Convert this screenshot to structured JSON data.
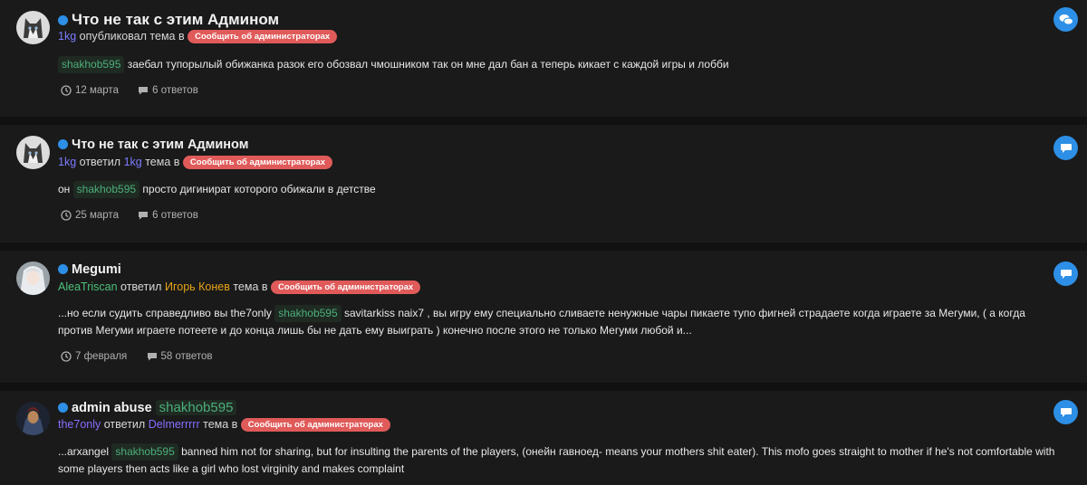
{
  "posts": [
    {
      "title": "Что не так с этим Админом",
      "actor": "1kg",
      "verb": "опубликовал тема в",
      "forum": "Сообщить об администраторах",
      "mention": "shakhob595",
      "text": "заебал тупорылый обижанка разок его обозвал чмошником так он мне дал бан а теперь кикает с каждой игры и лобби",
      "date": "12 марта",
      "replies": "6 ответов"
    },
    {
      "title": "Что не так с этим Админом",
      "actor": "1kg",
      "verb": "ответил",
      "target": "1kg",
      "verb2": "тема в",
      "forum": "Сообщить об администраторах",
      "text_before": "он",
      "mention": "shakhob595",
      "text": "просто дигинират которого обижали в детстве",
      "date": "25 марта",
      "replies": "6 ответов"
    },
    {
      "title": "Megumi",
      "actor": "AleaTriscan",
      "verb": "ответил",
      "target": "Игорь Конев",
      "verb2": "тема в",
      "forum": "Сообщить об администраторах",
      "text_before": "...но если судить справедливо вы the7only",
      "mention": "shakhob595",
      "text": "savitarkiss naix7 , вы игру ему специально сливаете ненужные чары пикаете тупо фигней страдаете когда играете за Мегуми, ( а когда против Мегуми играете потеете и до конца лишь бы не дать ему выиграть ) конечно после этого не только Мегуми любой и...",
      "date": "7 февраля",
      "replies": "58 ответов"
    },
    {
      "title": "admin abuse",
      "title_mention": "shakhob595",
      "actor": "the7only",
      "verb": "ответил",
      "target": "Delmerrrrr",
      "verb2": "тема в",
      "forum": "Сообщить об администраторах",
      "text_before": "...arxangel",
      "mention": "shakhob595",
      "text": "banned him not for sharing, but for insulting the parents of the players, (онейн гавноед- means your mothers shit eater). This mofo goes straight to mother if he's not comfortable with some players then acts like a girl who lost virginity and makes complaint"
    }
  ],
  "colors": {
    "accent": "#2d8fe6",
    "forum_pill": "#e05a5a",
    "mention": "#4caf7a"
  },
  "icons": {
    "reply_button": "chat-bubble-icon",
    "date": "clock-icon",
    "replies": "comment-icon",
    "online": "online-dot"
  }
}
